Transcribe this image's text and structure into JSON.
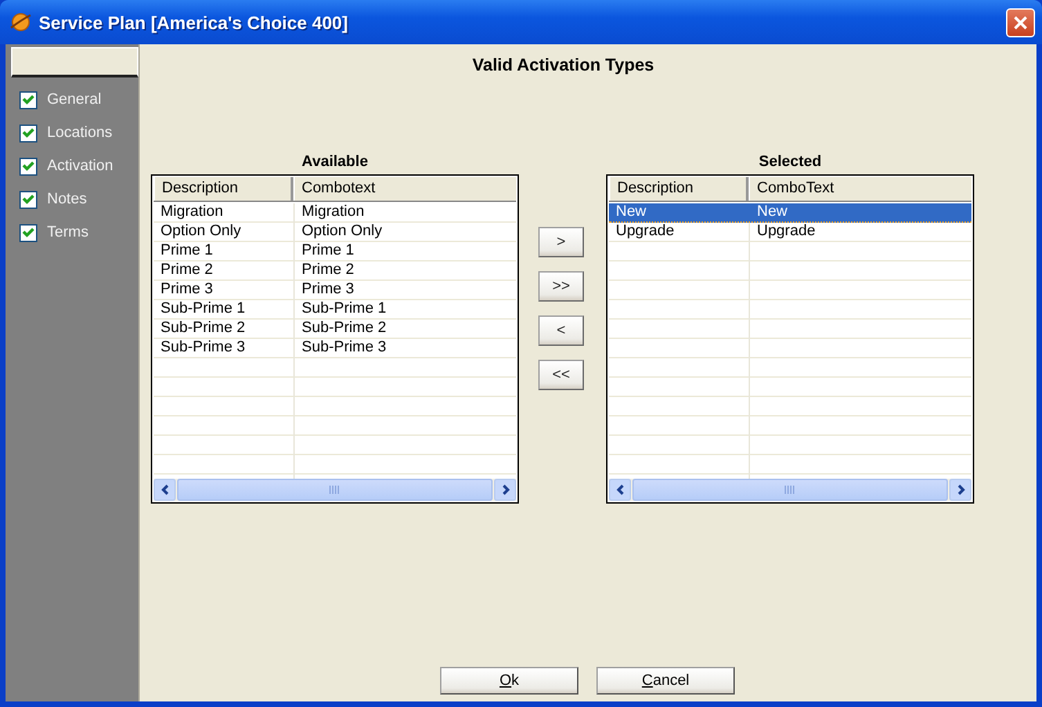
{
  "window": {
    "title": "Service Plan [America's Choice 400]"
  },
  "sidebar": {
    "items": [
      {
        "label": "General",
        "checked": true
      },
      {
        "label": "Locations",
        "checked": true
      },
      {
        "label": "Activation",
        "checked": true
      },
      {
        "label": "Notes",
        "checked": true
      },
      {
        "label": "Terms",
        "checked": true
      }
    ]
  },
  "heading": "Valid Activation Types",
  "available": {
    "title": "Available",
    "columns": [
      "Description",
      "Combotext"
    ],
    "rows": [
      {
        "cells": [
          "Migration",
          "Migration"
        ],
        "selected": false
      },
      {
        "cells": [
          "Option Only",
          "Option Only"
        ],
        "selected": false
      },
      {
        "cells": [
          "Prime 1",
          "Prime 1"
        ],
        "selected": false
      },
      {
        "cells": [
          "Prime 2",
          "Prime 2"
        ],
        "selected": false
      },
      {
        "cells": [
          "Prime 3",
          "Prime 3"
        ],
        "selected": false
      },
      {
        "cells": [
          "Sub-Prime 1",
          "Sub-Prime 1"
        ],
        "selected": false
      },
      {
        "cells": [
          "Sub-Prime 2",
          "Sub-Prime 2"
        ],
        "selected": false
      },
      {
        "cells": [
          "Sub-Prime 3",
          "Sub-Prime 3"
        ],
        "selected": false
      }
    ]
  },
  "move_buttons": [
    ">",
    ">>",
    "<",
    "<<"
  ],
  "selected": {
    "title": "Selected",
    "columns": [
      "Description",
      "ComboText"
    ],
    "rows": [
      {
        "cells": [
          "New",
          "New"
        ],
        "selected": true
      },
      {
        "cells": [
          "Upgrade",
          "Upgrade"
        ],
        "selected": false
      }
    ]
  },
  "footer_buttons": [
    {
      "label": "Ok",
      "first_letter_underlined": true
    },
    {
      "label": "Cancel",
      "first_letter_underlined": true
    }
  ]
}
